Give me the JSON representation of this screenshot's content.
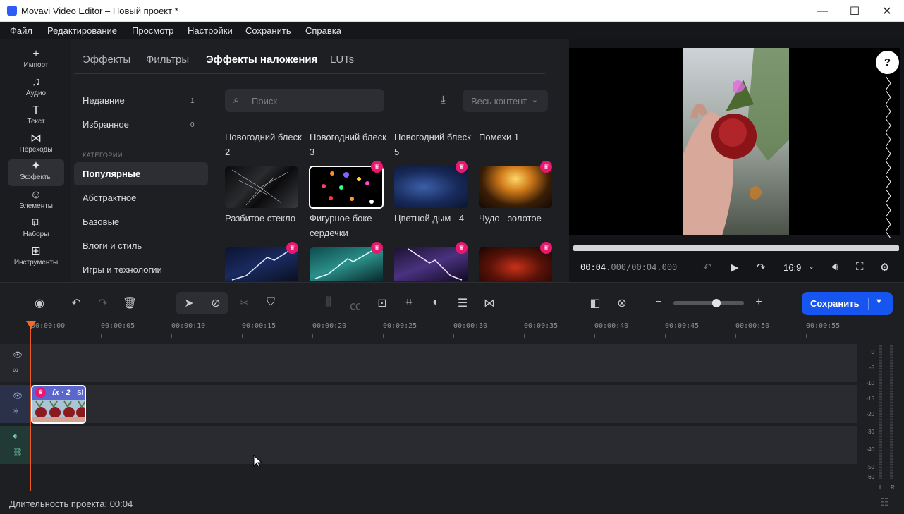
{
  "window": {
    "title": "Movavi Video Editor – Новый проект *",
    "controls": [
      "—",
      "☐",
      "✕"
    ]
  },
  "menu": [
    "Файл",
    "Редактирование",
    "Просмотр",
    "Настройки",
    "Сохранить",
    "Справка"
  ],
  "rail": [
    {
      "label": "Импорт",
      "icon": "plus-icon",
      "glyph": "+"
    },
    {
      "label": "Аудио",
      "icon": "music-note-icon",
      "glyph": "♫"
    },
    {
      "label": "Текст",
      "icon": "text-t-icon",
      "glyph": "T"
    },
    {
      "label": "Переходы",
      "icon": "transition-bowtie-icon",
      "glyph": "⋈"
    },
    {
      "label": "Эффекты",
      "icon": "sparkles-icon",
      "glyph": "✦"
    },
    {
      "label": "Элементы",
      "icon": "smiley-icon",
      "glyph": "☺"
    },
    {
      "label": "Наборы",
      "icon": "bag-icon",
      "glyph": "⧉"
    },
    {
      "label": "Инструменты",
      "icon": "grid-tools-icon",
      "glyph": "⊞"
    }
  ],
  "tabs": [
    "Эффекты",
    "Фильтры",
    "Эффекты наложения",
    "LUTs"
  ],
  "categories": {
    "recent": {
      "label": "Недавние",
      "count": "1"
    },
    "favorites": {
      "label": "Избранное",
      "count": "0"
    },
    "heading": "КАТЕГОРИИ",
    "items": [
      "Популярные",
      "Абстрактное",
      "Базовые",
      "Влоги и стиль",
      "Игры и технологии"
    ]
  },
  "search": {
    "placeholder": "Поиск"
  },
  "content_filter": {
    "value": "Весь контент"
  },
  "effects": {
    "row0_names": [
      "Новогодний блеск 2",
      "Новогодний блеск 3",
      "Новогодний блеск 5",
      "Помехи 1"
    ],
    "row1_names": [
      "Разбитое стекло",
      "Фигурное боке - сердечки",
      "Цветной дым - 4",
      "Чудо - золотое"
    ]
  },
  "preview": {
    "help": "?",
    "time_current": "00:04",
    "time_rest": ".000/00:04.000",
    "aspect": "16:9"
  },
  "save_button": {
    "label": "Сохранить"
  },
  "ruler": [
    "00:00:00",
    "00:00:05",
    "00:00:10",
    "00:00:15",
    "00:00:20",
    "00:00:25",
    "00:00:30",
    "00:00:35",
    "00:00:40",
    "00:00:45",
    "00:00:50",
    "00:00:55"
  ],
  "clip": {
    "fx": "fx · 2",
    "name": "Sl"
  },
  "meter": {
    "labels": [
      "0",
      "-5",
      "-10",
      "-15",
      "-20",
      "-30",
      "-40",
      "-50",
      "-60"
    ],
    "channels": [
      "L",
      "R"
    ]
  },
  "status": {
    "duration": "Длительность проекта: 00:04"
  },
  "colors": {
    "accent": "#1655f0",
    "crown": "#e8186e",
    "playhead": "#ee5a24",
    "video_track": "#2b3148",
    "audio_track": "#213a36"
  }
}
